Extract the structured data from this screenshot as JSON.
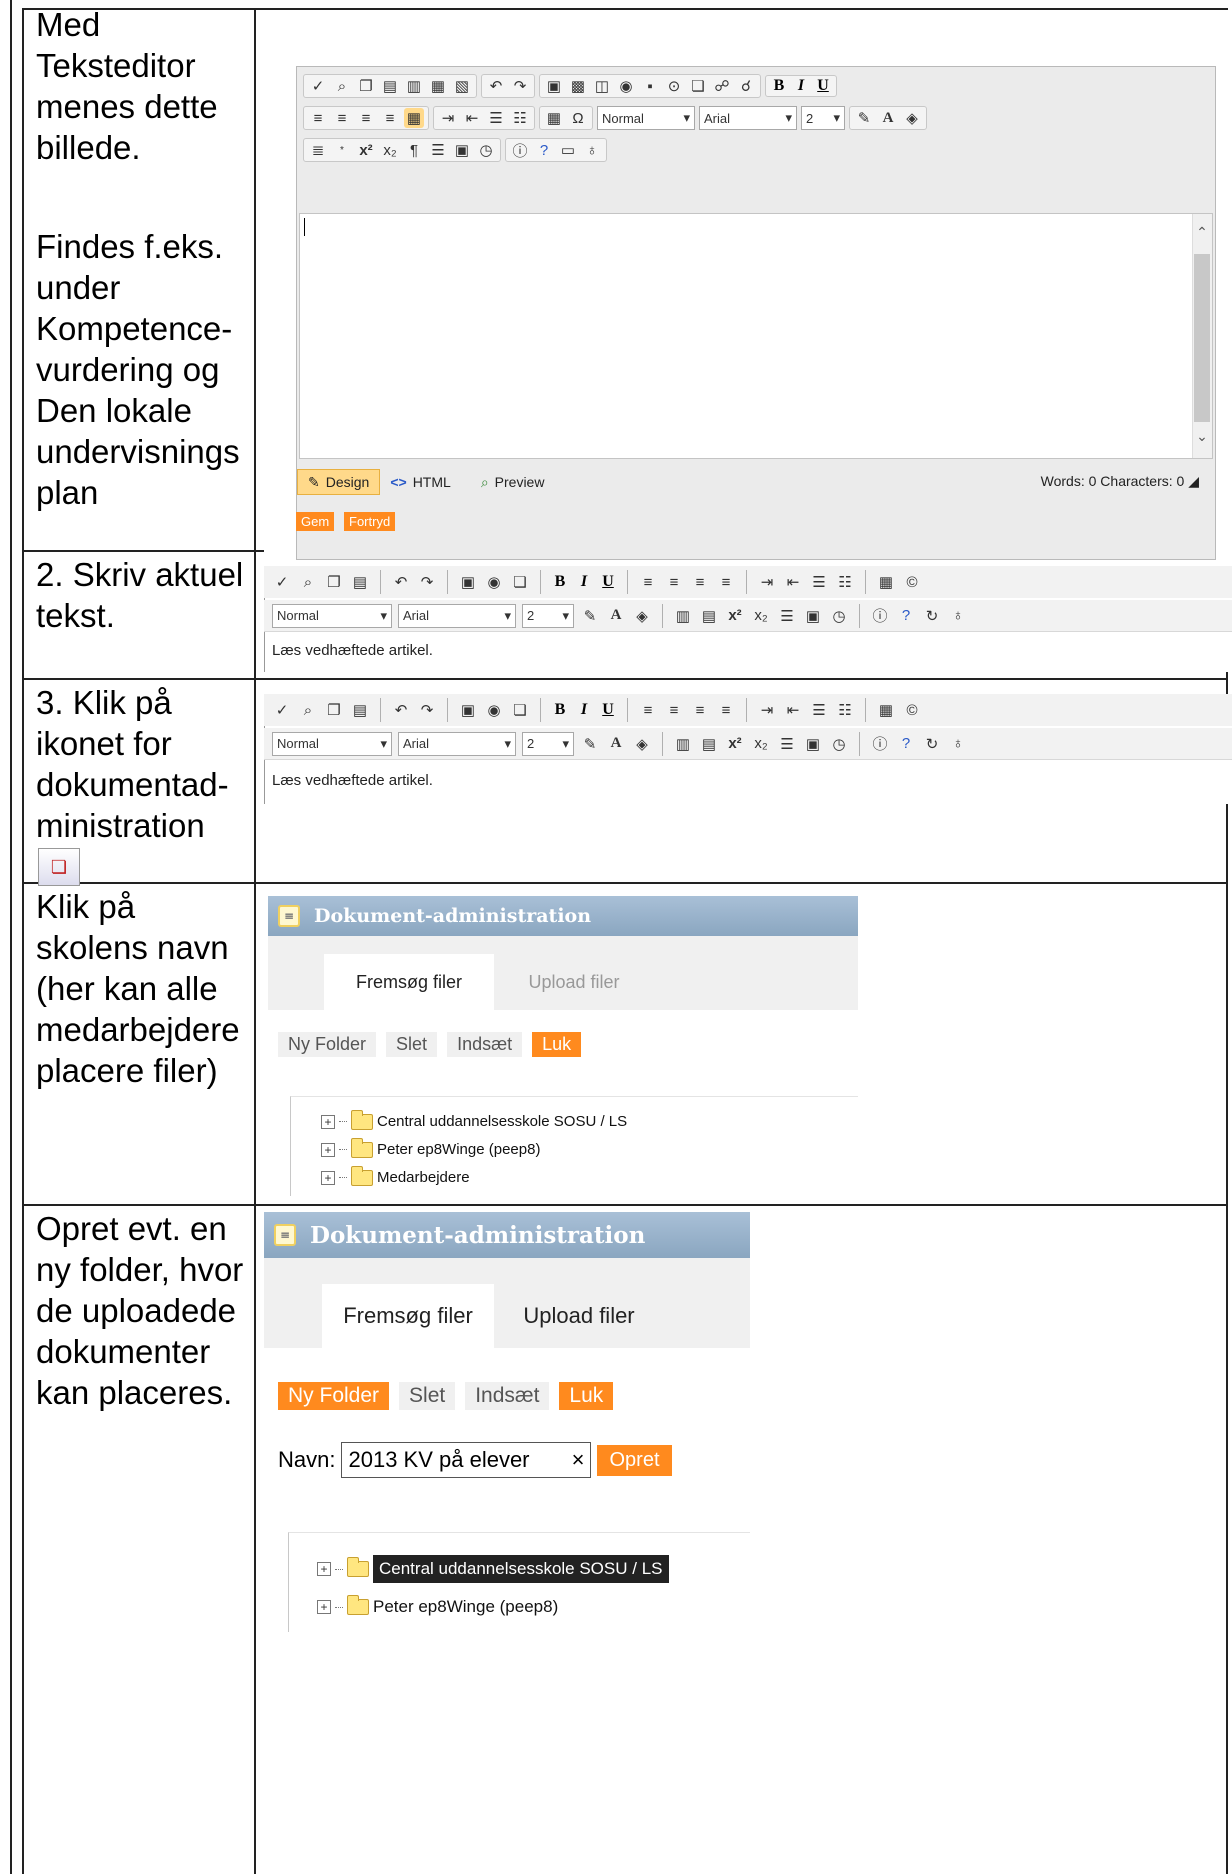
{
  "rows": [
    {
      "left_text": [
        "Med",
        "Teksteditor",
        "menes dette",
        "billede."
      ],
      "left_text_2": [
        "Findes f.eks.",
        "under",
        "Kompetence-",
        "vurdering og",
        "Den lokale",
        "undervisnings",
        "plan"
      ],
      "editor": {
        "style_select": "Normal",
        "font_select": "Arial",
        "size_select": "2",
        "modes": [
          "Design",
          "HTML",
          "Preview"
        ],
        "status": "Words: 0  Characters: 0",
        "buttons": [
          "Gem",
          "Fortryd"
        ]
      }
    },
    {
      "left_text": [
        "2. Skriv aktuel",
        "tekst."
      ],
      "editor": {
        "style_select": "Normal",
        "font_select": "Arial",
        "size_select": "2",
        "content": "Læs vedhæftede artikel."
      }
    },
    {
      "left_text": [
        "3. Klik på",
        "ikonet for",
        "dokumentad-",
        "ministration"
      ],
      "editor": {
        "style_select": "Normal",
        "font_select": "Arial",
        "size_select": "2",
        "content": "Læs vedhæftede artikel."
      }
    },
    {
      "left_text": [
        "Klik på",
        "skolens navn",
        "(her kan alle",
        "medarbejdere",
        "placere filer)"
      ],
      "panel": {
        "title": "Dokument-administration",
        "tabs": [
          "Fremsøg filer",
          "Upload filer"
        ],
        "actions": [
          "Ny Folder",
          "Slet",
          "Indsæt",
          "Luk"
        ],
        "tree": [
          "Central uddannelsesskole SOSU / LS",
          "Peter ep8Winge (peep8)",
          "Medarbejdere"
        ]
      }
    },
    {
      "left_text": [
        "Opret evt. en",
        "ny folder, hvor",
        "de uploadede",
        "dokumenter",
        "kan placeres."
      ],
      "panel": {
        "title": "Dokument-administration",
        "tabs": [
          "Fremsøg filer",
          "Upload filer"
        ],
        "actions": [
          "Ny Folder",
          "Slet",
          "Indsæt",
          "Luk"
        ],
        "navn_label": "Navn:",
        "navn_value": "2013 KV på elever",
        "clear": "×",
        "opret": "Opret",
        "tree": [
          "Central uddannelsesskole SOSU / LS",
          "Peter ep8Winge (peep8)"
        ]
      }
    }
  ],
  "colors": {
    "orange": "#ff8a1e",
    "header_blue": "#9bb4cc",
    "border": "#222222"
  },
  "icons": [
    "spellcheck-icon",
    "find-icon",
    "copy-icon",
    "paste-icon",
    "undo-icon",
    "redo-icon",
    "image-icon",
    "flash-icon",
    "document-manager-icon",
    "table-icon",
    "symbol-icon",
    "color-icon",
    "clock-icon",
    "help-icon",
    "folder-icon",
    "plus-icon"
  ]
}
